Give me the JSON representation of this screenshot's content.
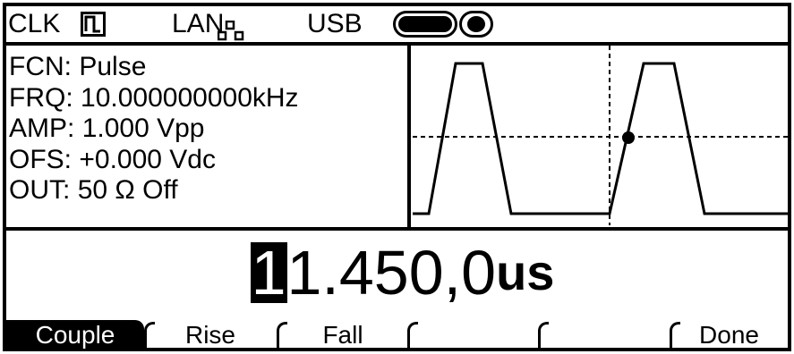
{
  "status": {
    "clk_label": "CLK",
    "clk_icon": "square-pulse-icon",
    "lan_label": "LAN",
    "lan_icon": "network-nodes-icon",
    "usb_label": "USB",
    "usb_icon": "usb-connected-icon"
  },
  "params": [
    {
      "label": "FCN:",
      "value": "Pulse"
    },
    {
      "label": "FRQ:",
      "value": "10.000000000kHz"
    },
    {
      "label": "AMP:",
      "value": "1.000 Vpp"
    },
    {
      "label": "OFS:",
      "value": "+0.000 Vdc"
    },
    {
      "label": "OUT:",
      "value": "50 Ω Off"
    }
  ],
  "waveform": {
    "type": "pulse",
    "icon": "pulse-waveform-plot"
  },
  "entry": {
    "cursor_digit": "1",
    "rest": "1.450,0",
    "unit": "us"
  },
  "softkeys": [
    {
      "label": "Couple",
      "selected": true
    },
    {
      "label": "Rise",
      "selected": false
    },
    {
      "label": "Fall",
      "selected": false
    },
    {
      "label": "",
      "selected": false
    },
    {
      "label": "",
      "selected": false
    },
    {
      "label": "Done",
      "selected": false
    }
  ]
}
